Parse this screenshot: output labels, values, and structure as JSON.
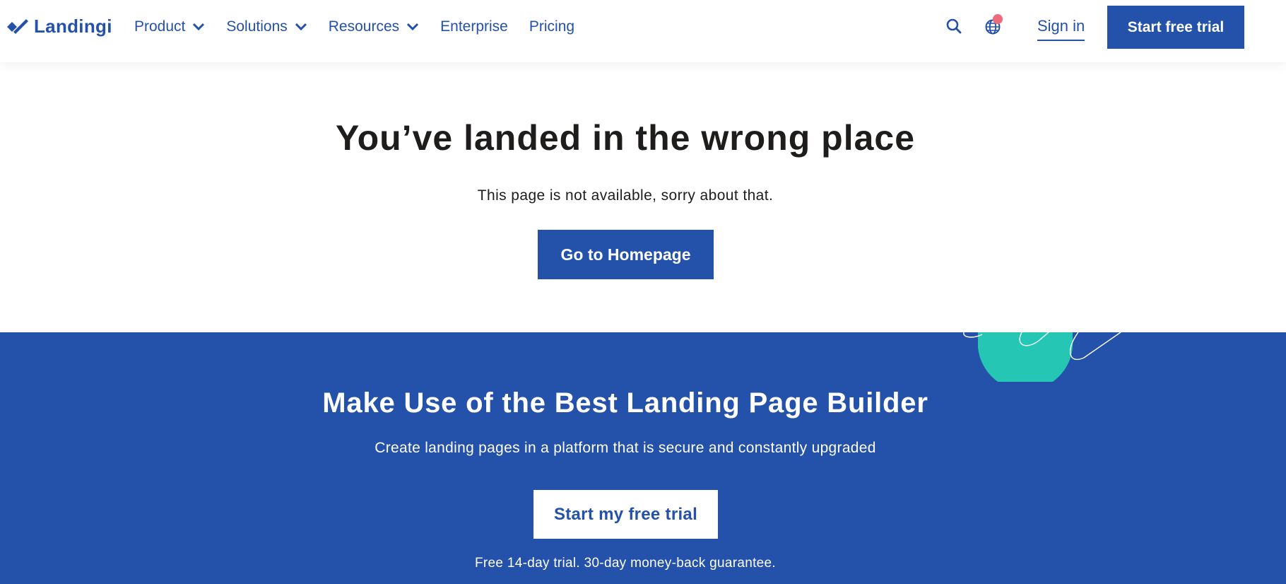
{
  "header": {
    "logo_text": "Landingi",
    "nav": [
      {
        "label": "Product",
        "has_dropdown": true
      },
      {
        "label": "Solutions",
        "has_dropdown": true
      },
      {
        "label": "Resources",
        "has_dropdown": true
      },
      {
        "label": "Enterprise",
        "has_dropdown": false
      },
      {
        "label": "Pricing",
        "has_dropdown": false
      }
    ],
    "icons": [
      "search-icon",
      "globe-icon",
      "notification-dot"
    ],
    "signin_label": "Sign in",
    "trial_label": "Start free trial"
  },
  "error": {
    "title": "You’ve landed in the wrong place",
    "subtitle": "This page is not available, sorry about that.",
    "button_label": "Go to Homepage"
  },
  "cta": {
    "title": "Make Use of the Best Landing Page Builder",
    "subtitle": "Create landing pages in a platform that is secure and constantly upgraded",
    "button_label": "Start my free trial",
    "note": "Free 14-day trial. 30-day money-back guarantee."
  },
  "colors": {
    "brand_blue": "#2451aa",
    "accent_teal": "#25c7b4",
    "notification_pink": "#ee6a7d",
    "text_dark": "#1f1d1c",
    "white": "#ffffff"
  }
}
